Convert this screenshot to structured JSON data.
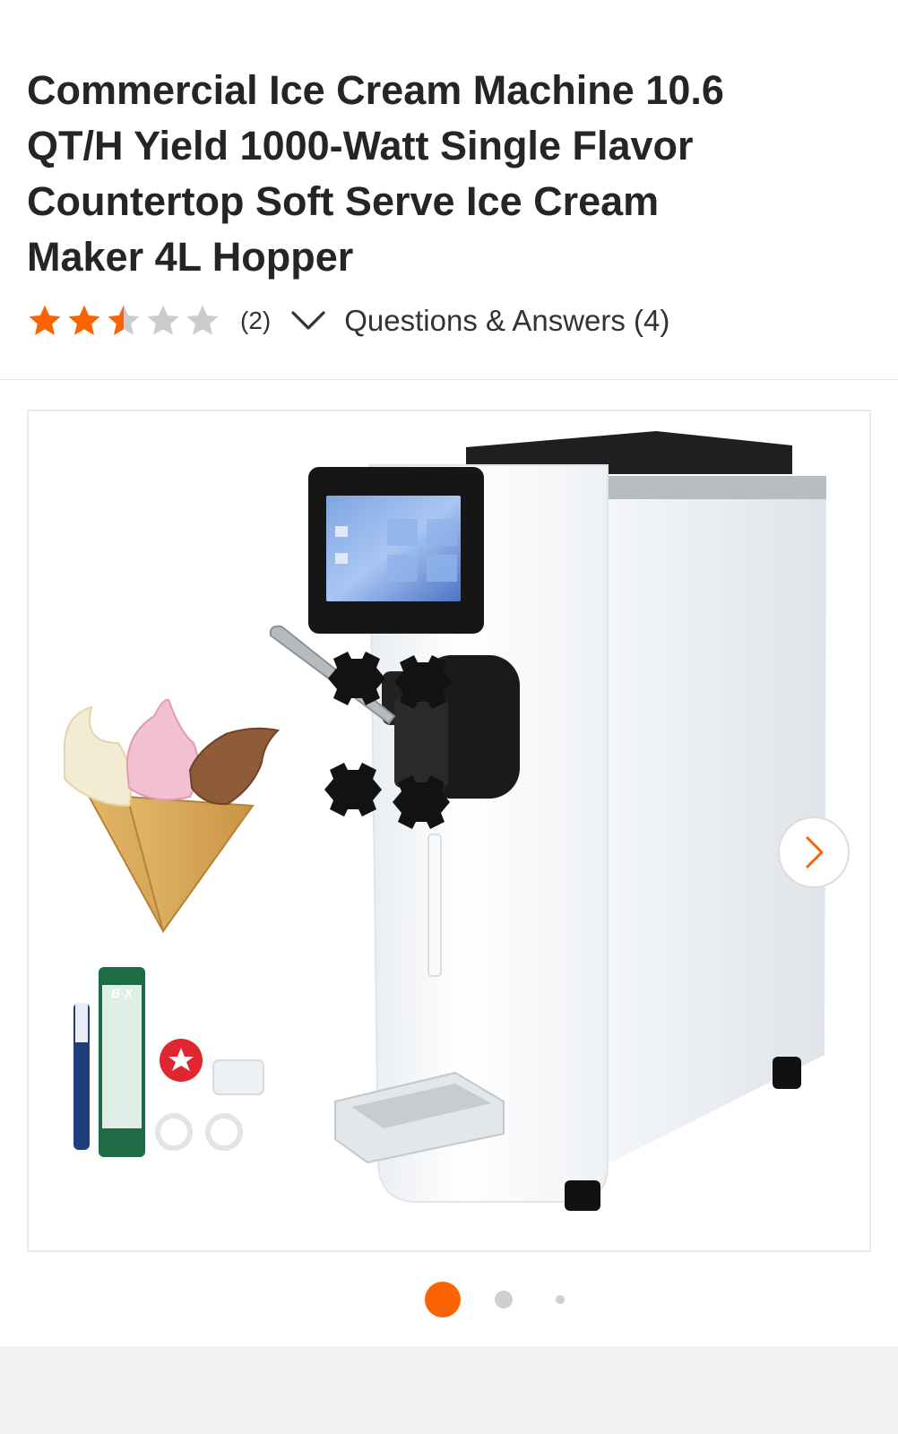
{
  "product": {
    "title": "Commercial Ice Cream Machine 10.6 QT/H Yield 1000-Watt Single Flavor Countertop Soft Serve Ice Cream Maker 4L Hopper"
  },
  "rating": {
    "stars": 2.5,
    "max": 5,
    "review_count_label": "(2)",
    "questions_label": "Questions & Answers (4)",
    "star_color": "#f96302",
    "empty_star_color": "#cccccc"
  },
  "gallery": {
    "current_index": 0,
    "total_dots": 3,
    "active_color": "#f96302",
    "next_icon": "chevron-right-icon",
    "tube_brand": "B·X"
  },
  "icons": {
    "expand": "chevron-down-icon",
    "next": "chevron-right-icon"
  }
}
